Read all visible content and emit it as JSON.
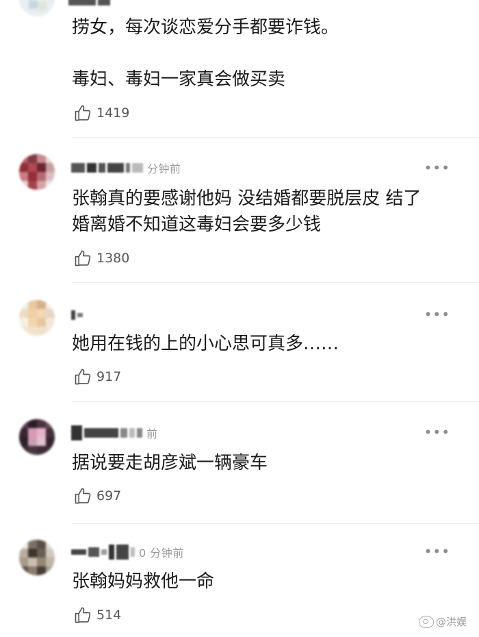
{
  "comments": [
    {
      "text_lines": [
        "捞女，每次谈恋爱分手都要诈钱。",
        "",
        "毒妇、毒妇一家真会做买卖"
      ],
      "time": "",
      "likes": "1419"
    },
    {
      "text_lines": [
        "张翰真的要感谢他妈 没结婚都要脱层皮 结了",
        "婚离婚不知道这毒妇会要多少钱"
      ],
      "time": "分钟前",
      "likes": "1380"
    },
    {
      "text_lines": [
        "她用在钱的上的小心思可真多……"
      ],
      "time": "",
      "likes": "917"
    },
    {
      "text_lines": [
        "据说要走胡彦斌一辆豪车"
      ],
      "time": "前",
      "likes": "697"
    },
    {
      "text_lines": [
        "张翰妈妈救他一命"
      ],
      "time": "0 分钟前",
      "likes": "514"
    }
  ],
  "more_label": "•••",
  "watermark": "@洪娱",
  "icons": {
    "like": "thumbs-up-icon",
    "more": "more-dots-icon",
    "watermark": "weibo-logo-icon"
  }
}
